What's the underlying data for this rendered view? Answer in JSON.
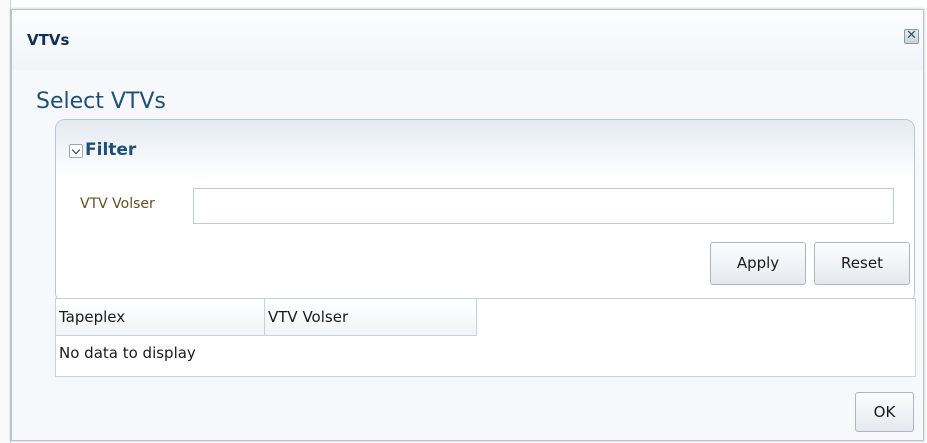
{
  "dialog": {
    "title": "VTVs",
    "close_icon": "close-icon"
  },
  "heading": "Select VTVs",
  "filter": {
    "label": "Filter",
    "toggle_icon": "chevron-down-icon",
    "field_label": "VTV Volser",
    "field_value": "",
    "apply_label": "Apply",
    "reset_label": "Reset"
  },
  "table": {
    "columns": [
      "Tapeplex",
      "VTV Volser"
    ],
    "empty_message": "No data to display"
  },
  "footer": {
    "ok_label": "OK"
  }
}
